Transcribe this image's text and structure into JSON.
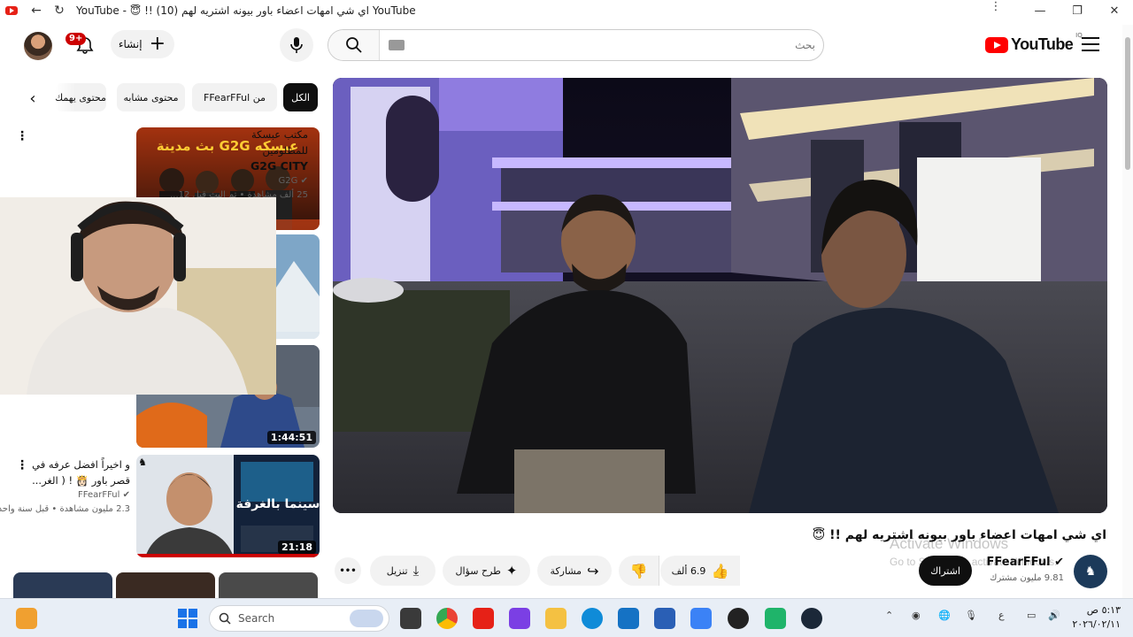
{
  "browser": {
    "tab_title": "YouTube - 😇 !! اي شي امهات اعضاء باور بيونه اشتريه لهم (10) YouTube",
    "back_icon": "arrow-left-icon",
    "reload_icon": "reload-icon",
    "window_controls": [
      "—",
      "❐",
      "✕"
    ]
  },
  "header": {
    "notification_count": "9+",
    "create_label": "إنشاء",
    "search_placeholder": "بحث",
    "logo_text": "YouTube",
    "logo_country": "IQ"
  },
  "chips": {
    "all": "الكل",
    "from_channel": "من FFearFFul",
    "similar": "محتوى مشابه",
    "more": "محتوى يهمك"
  },
  "recommendations": [
    {
      "title_line1": "مكتب عبسكة للمظلومين",
      "title_line2": "G2G CITY",
      "channel": "G2G",
      "meta": "25 ألف مشاهدة • تم البث قبل 12...",
      "thumb_text": "بث مدينة G2G عبسكه"
    },
    {
      "duration": "1:44:51"
    },
    {
      "title_line1": "و اخيراً افضل عرفه في",
      "title_line2": "قصر باور 👸🏻 ! ( الغر...",
      "channel": "FFearFFul",
      "meta": "2.3 مليون مشاهدة • قبل سنة واحدة",
      "duration": "21:18",
      "thumb_text": "سينما بالغرفة"
    }
  ],
  "video": {
    "title": "اي شي امهات اعضاء باور بيونه اشتريه لهم !! 😇",
    "channel_name": "FFearFFul",
    "subscribers": "9.81 مليون مشترك",
    "subscribe_label": "اشتراك",
    "likes": "6.9 ألف",
    "share_label": "مشاركة",
    "ask_label": "طرح سؤال",
    "download_label": "تنزيل",
    "more_label": "•••"
  },
  "watermark": {
    "line1": "Activate Windows",
    "line2": "Go to Settings to activate Windows."
  },
  "taskbar": {
    "search_label": "Search",
    "lang": "ع",
    "time": "٥:١٣ ص",
    "date": "٢٠٢٦/٠٢/١١"
  }
}
